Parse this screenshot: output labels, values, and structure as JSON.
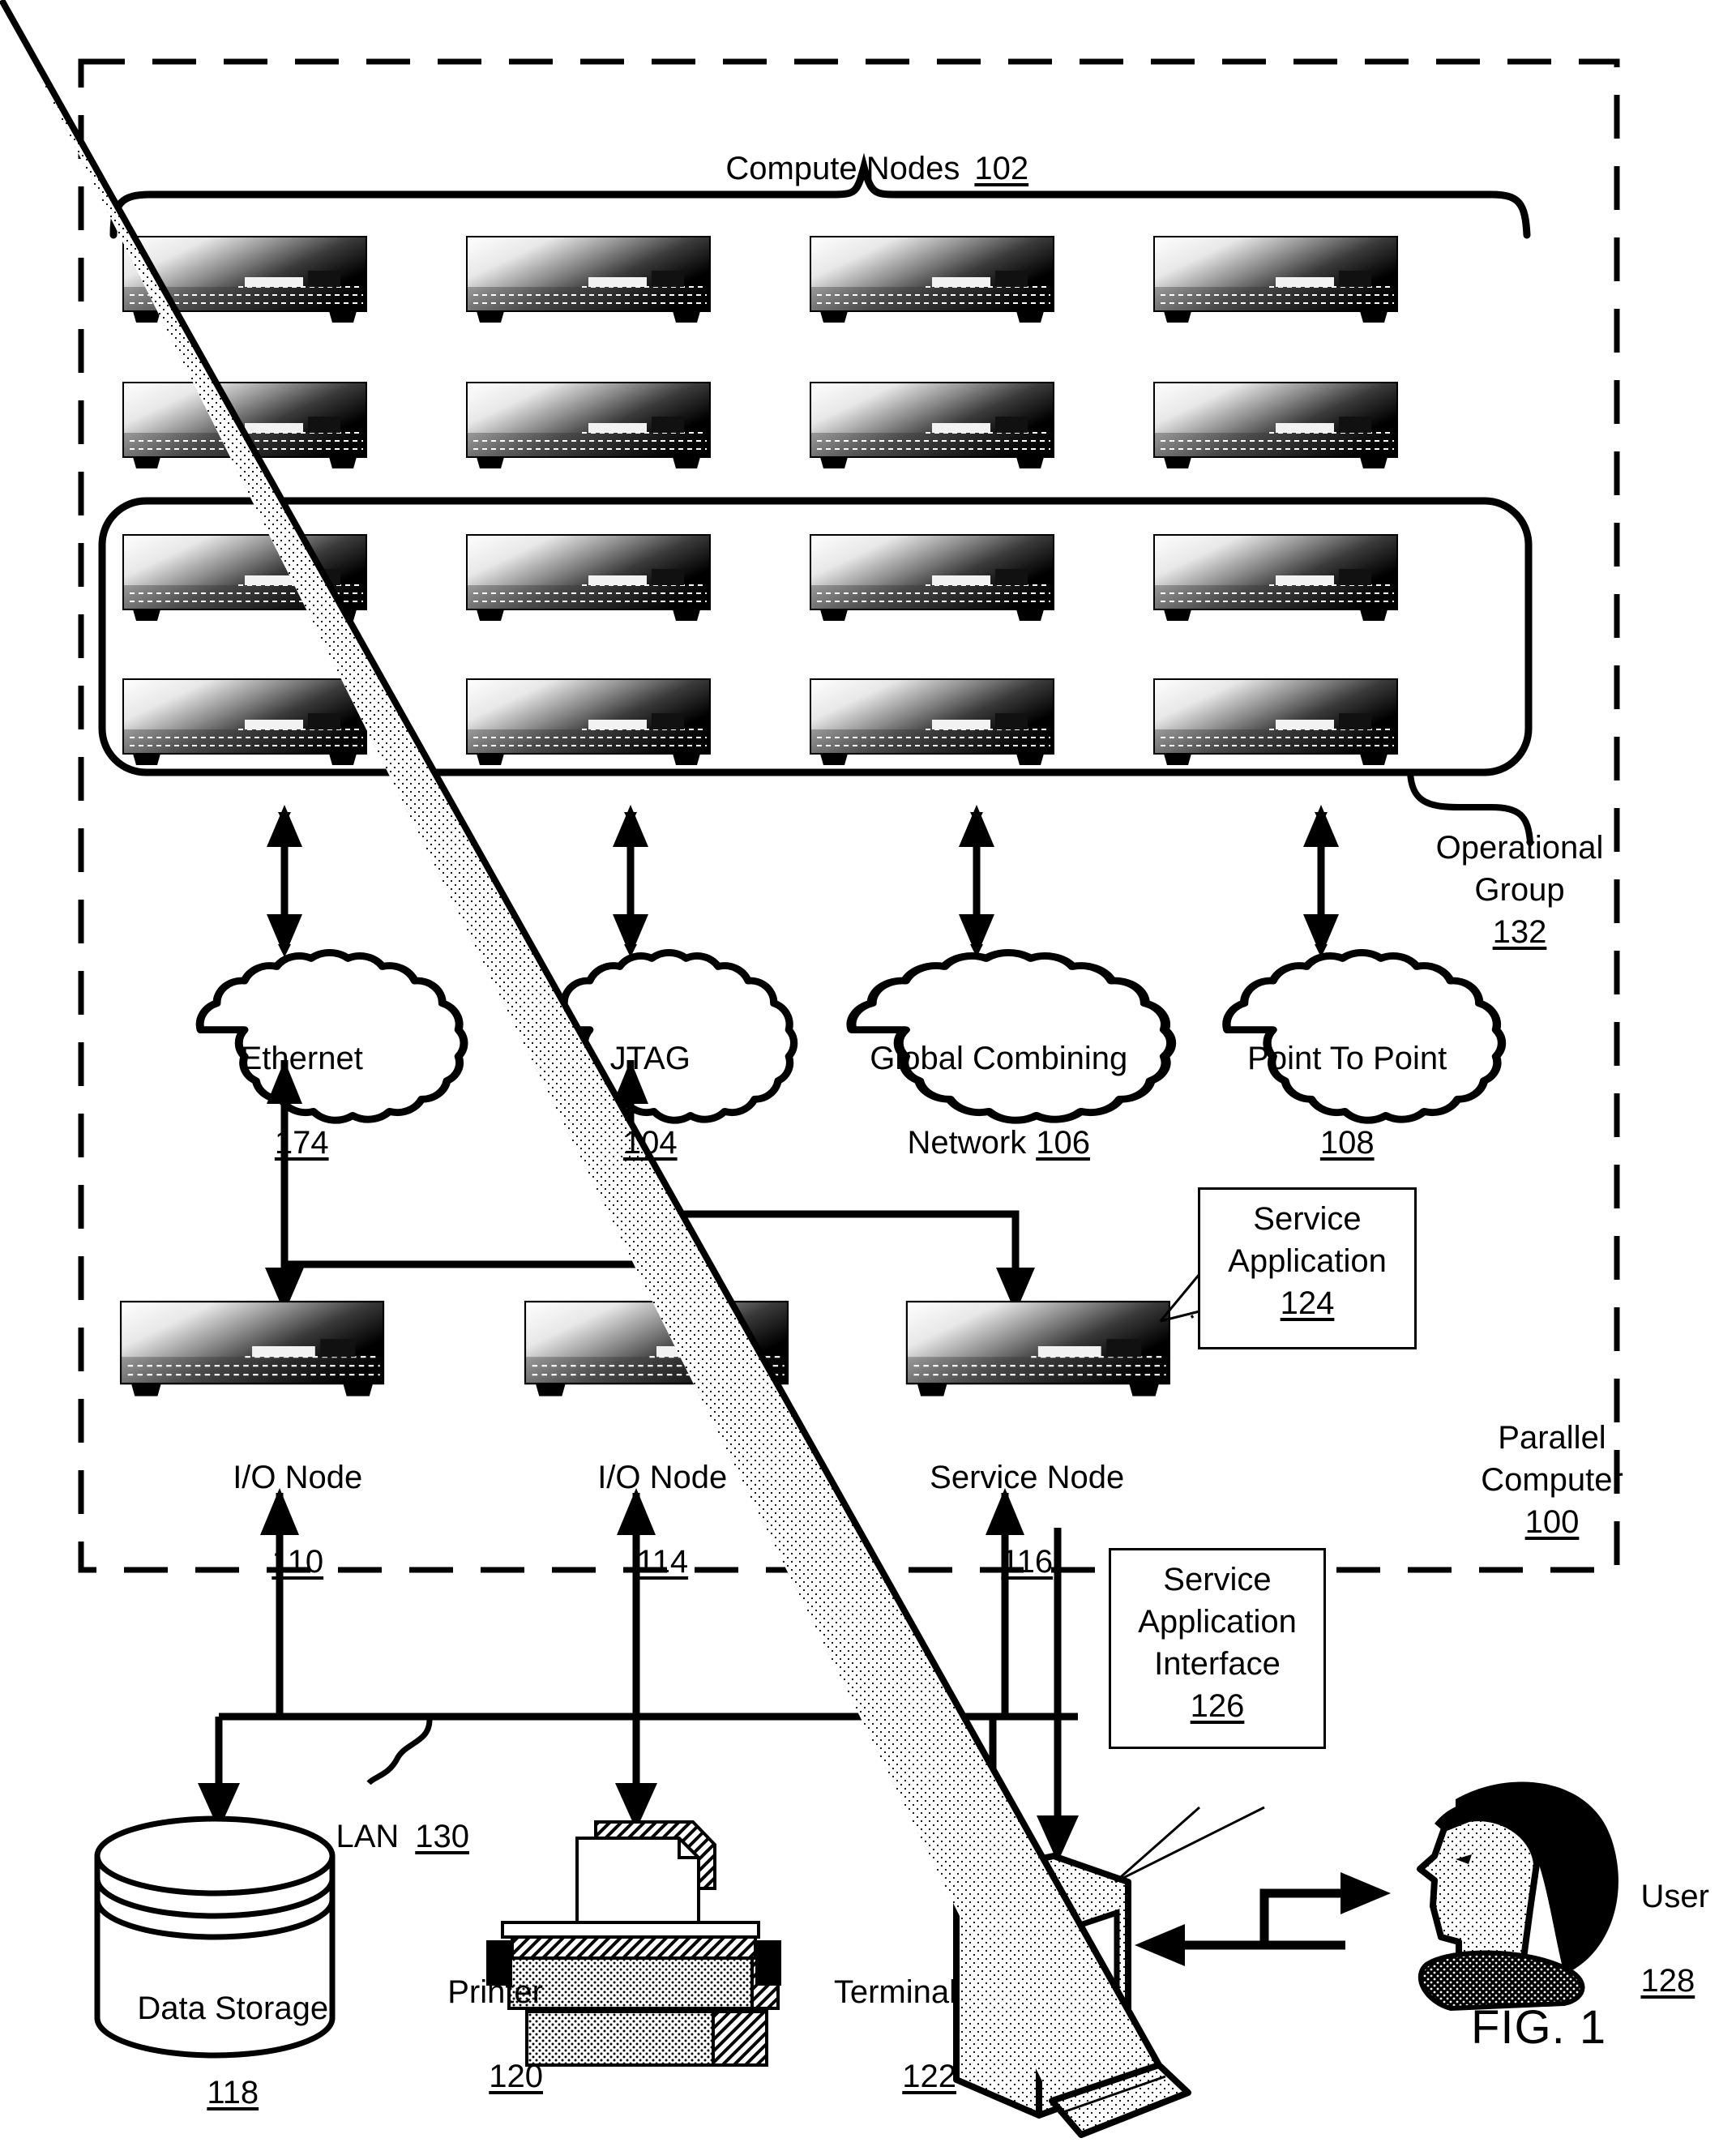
{
  "figure": {
    "caption": "FIG. 1",
    "title": "Compute Nodes",
    "title_ref": "102"
  },
  "outer_boundary": {
    "label_line1": "Parallel",
    "label_line2": "Computer",
    "ref": "100"
  },
  "operational_group": {
    "label_line1": "Operational",
    "label_line2": "Group",
    "ref": "132"
  },
  "compute_nodes": {
    "rows": 4,
    "columns": 4,
    "total": 16,
    "in_operational_group_rows": 2
  },
  "networks": [
    {
      "name": "network-ethernet",
      "label": "Ethernet",
      "ref": "174",
      "lines": [
        "Ethernet"
      ]
    },
    {
      "name": "network-jtag",
      "label": "JTAG",
      "ref": "104",
      "lines": [
        "JTAG"
      ]
    },
    {
      "name": "network-global-combining",
      "label": "Global Combining Network",
      "ref": "106",
      "lines": [
        "Global Combining",
        "Network"
      ]
    },
    {
      "name": "network-point-to-point",
      "label": "Point To Point",
      "ref": "108",
      "lines": [
        "Point To Point"
      ]
    }
  ],
  "nodes": [
    {
      "name": "io-node-110",
      "label": "I/O Node",
      "ref": "110"
    },
    {
      "name": "io-node-114",
      "label": "I/O Node",
      "ref": "114"
    },
    {
      "name": "service-node-116",
      "label": "Service Node",
      "ref": "116"
    }
  ],
  "callouts": [
    {
      "name": "service-application",
      "lines": [
        "Service",
        "Application"
      ],
      "ref": "124"
    },
    {
      "name": "service-application-interface",
      "lines": [
        "Service",
        "Application",
        "Interface"
      ],
      "ref": "126"
    }
  ],
  "lan": {
    "label": "LAN",
    "ref": "130"
  },
  "peripherals": [
    {
      "name": "data-storage",
      "label": "Data Storage",
      "ref": "118"
    },
    {
      "name": "printer",
      "label": "Printer",
      "ref": "120"
    },
    {
      "name": "terminal",
      "label": "Terminal",
      "ref": "122"
    },
    {
      "name": "user",
      "label": "User",
      "ref": "128"
    }
  ],
  "colors": {
    "ink": "#000000",
    "paper": "#ffffff"
  }
}
